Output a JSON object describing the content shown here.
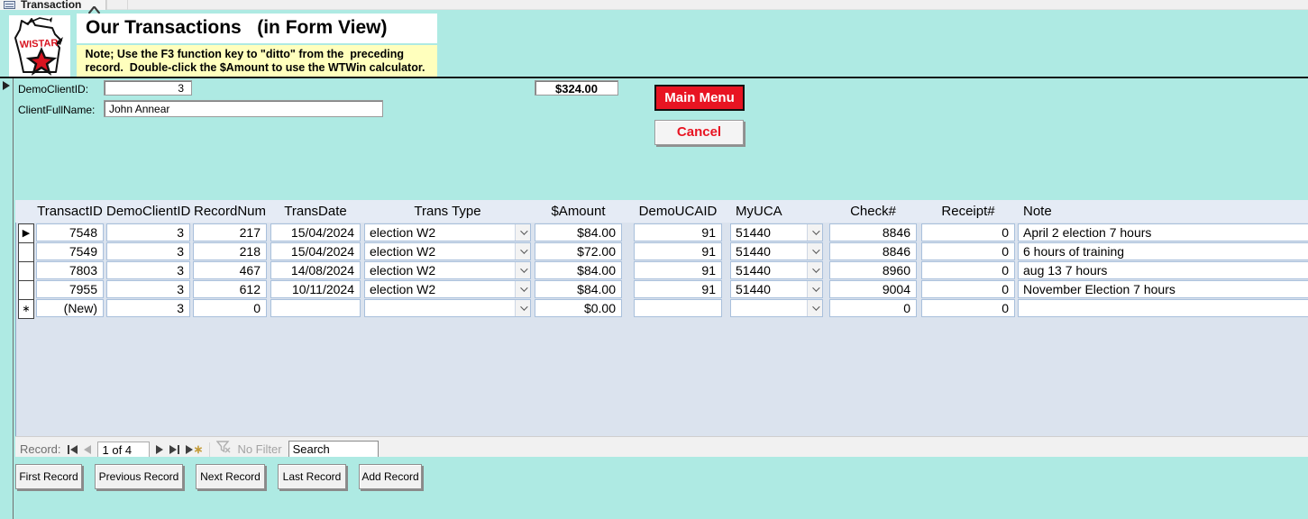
{
  "colors": {
    "background_teal": "#aeeae3",
    "accent_red": "#e81422",
    "note_yellow": "#ffffbd",
    "datasheet_bg": "#dbe3ee",
    "cell_border": "#a9c0dc"
  },
  "tab": {
    "title": "Transaction"
  },
  "logo": {
    "text": "WISTAR"
  },
  "header": {
    "title": "Our Transactions   (in Form View)",
    "note_line1": " Note; Use the F3 function key to \"ditto\" from the  preceding",
    "note_line2": " record.  Double-click the $Amount to use the WTWin calculator."
  },
  "client": {
    "id_label": "DemoClientID:",
    "id_value": "3",
    "name_label": "ClientFullName:",
    "name_value": "John Annear",
    "total_amount": "$324.00"
  },
  "actions": {
    "main_menu": "Main Menu",
    "cancel": "Cancel"
  },
  "datasheet": {
    "columns": [
      "TransactID",
      "DemoClientID",
      "RecordNum",
      "TransDate",
      "Trans Type",
      "$Amount",
      "DemoUCAID",
      "MyUCA",
      "Check#",
      "Receipt#",
      "Note"
    ],
    "rows": [
      {
        "sel": "▶",
        "transact_id": "7548",
        "demo_client_id": "3",
        "record_num": "217",
        "trans_date": "15/04/2024",
        "trans_type": "election W2",
        "amount": "$84.00",
        "demo_ucaid": "91",
        "my_uca": "51440",
        "check_num": "8846",
        "receipt_num": "0",
        "note": "April 2 election 7 hours"
      },
      {
        "sel": "",
        "transact_id": "7549",
        "demo_client_id": "3",
        "record_num": "218",
        "trans_date": "15/04/2024",
        "trans_type": "election W2",
        "amount": "$72.00",
        "demo_ucaid": "91",
        "my_uca": "51440",
        "check_num": "8846",
        "receipt_num": "0",
        "note": "6 hours of training"
      },
      {
        "sel": "",
        "transact_id": "7803",
        "demo_client_id": "3",
        "record_num": "467",
        "trans_date": "14/08/2024",
        "trans_type": "election W2",
        "amount": "$84.00",
        "demo_ucaid": "91",
        "my_uca": "51440",
        "check_num": "8960",
        "receipt_num": "0",
        "note": "aug 13 7 hours"
      },
      {
        "sel": "",
        "transact_id": "7955",
        "demo_client_id": "3",
        "record_num": "612",
        "trans_date": "10/11/2024",
        "trans_type": "election W2",
        "amount": "$84.00",
        "demo_ucaid": "91",
        "my_uca": "51440",
        "check_num": "9004",
        "receipt_num": "0",
        "note": "November Election 7 hours"
      },
      {
        "sel": "∗",
        "transact_id": "(New)",
        "demo_client_id": "3",
        "record_num": "0",
        "trans_date": "",
        "trans_type": "",
        "amount": "$0.00",
        "demo_ucaid": "",
        "my_uca": "",
        "check_num": "0",
        "receipt_num": "0",
        "note": ""
      }
    ]
  },
  "record_nav": {
    "label": "Record:",
    "position": "1 of 4",
    "no_filter": "No Filter",
    "search_placeholder": "Search"
  },
  "footer_buttons": [
    "First Record",
    "Previous Record",
    "Next Record",
    "Last Record",
    "Add Record"
  ]
}
